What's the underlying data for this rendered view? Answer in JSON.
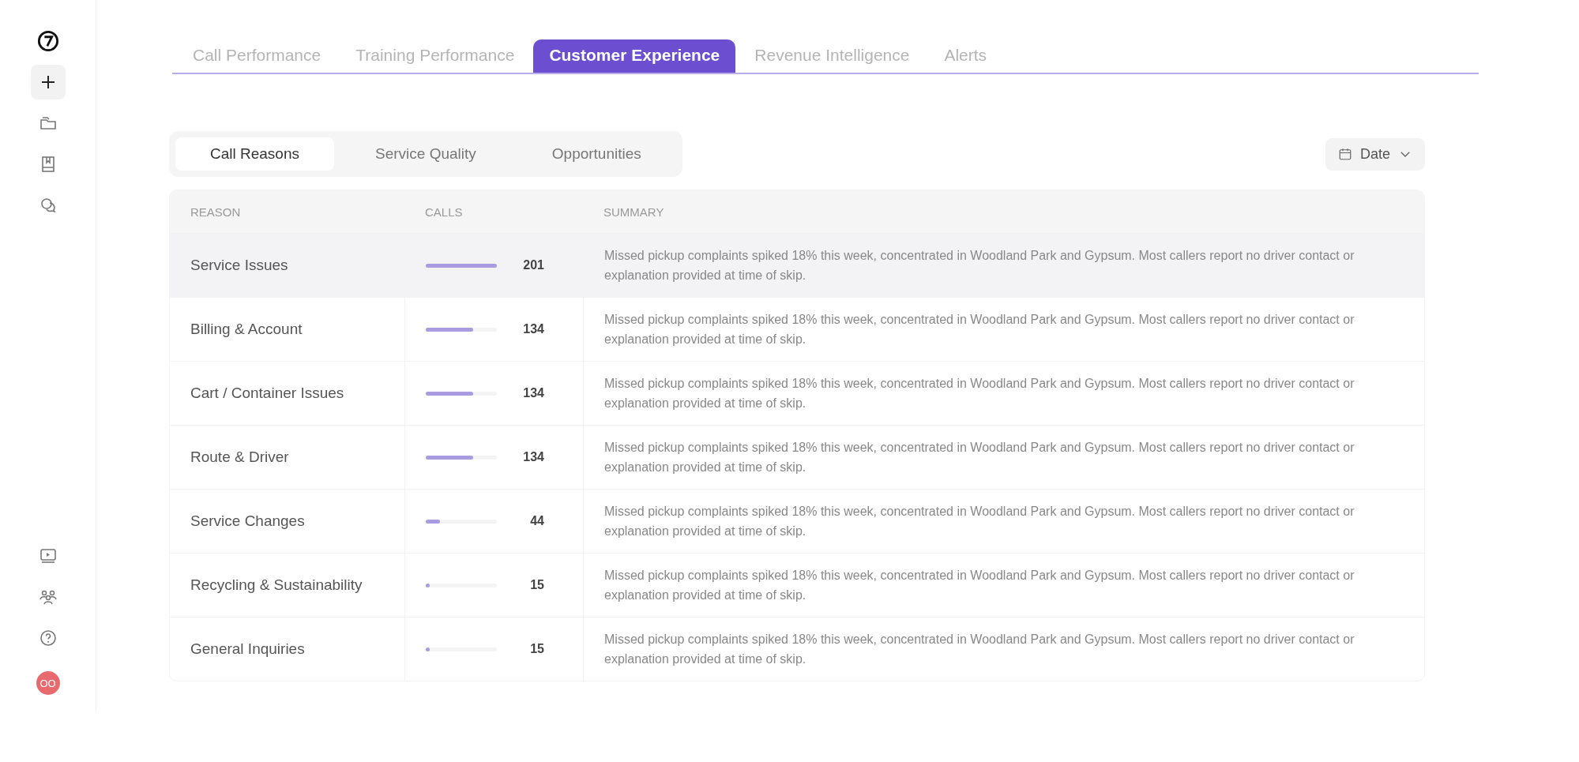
{
  "sidebar": {
    "top_items": [
      {
        "kind": "logo"
      },
      {
        "kind": "plus",
        "selected": true
      },
      {
        "kind": "folder",
        "selected": false
      },
      {
        "kind": "book",
        "selected": false
      },
      {
        "kind": "chat",
        "selected": false
      }
    ],
    "bottom_items": [
      {
        "kind": "video"
      },
      {
        "kind": "team"
      },
      {
        "kind": "help"
      }
    ],
    "avatar": {
      "initials": "OO",
      "color": "#e86a6f"
    }
  },
  "tabs": [
    {
      "label": "Call Performance",
      "selected": false
    },
    {
      "label": "Training Performance",
      "selected": false
    },
    {
      "label": "Customer Experience",
      "selected": true
    },
    {
      "label": "Revenue Intelligence",
      "selected": false
    },
    {
      "label": "Alerts",
      "selected": false
    }
  ],
  "subtabs": [
    {
      "label": "Call Reasons",
      "selected": true
    },
    {
      "label": "Service Quality",
      "selected": false
    },
    {
      "label": "Opportunities",
      "selected": false
    }
  ],
  "date_button": {
    "label": "Date"
  },
  "table": {
    "columns": [
      "REASON",
      "CALLS",
      "SUMMARY"
    ],
    "rows": [
      {
        "reason": "Service Issues",
        "level": 1,
        "calls": "201",
        "summary": "Missed pickup complaints spiked 18% this week, concentrated in Woodland Park and Gypsum. Most callers report no driver contact or explanation provided at time of skip.",
        "highlighted": true
      },
      {
        "reason": "Billing & Account",
        "level": 0.67,
        "calls": "134",
        "summary": "Missed pickup complaints spiked 18% this week, concentrated in Woodland Park and Gypsum. Most callers report no driver contact or explanation provided at time of skip.",
        "highlighted": false
      },
      {
        "reason": "Cart / Container Issues",
        "level": 0.67,
        "calls": "134",
        "summary": "Missed pickup complaints spiked 18% this week, concentrated in Woodland Park and Gypsum. Most callers report no driver contact or explanation provided at time of skip.",
        "highlighted": false
      },
      {
        "reason": "Route & Driver",
        "level": 0.67,
        "calls": "134",
        "summary": "Missed pickup complaints spiked 18% this week, concentrated in Woodland Park and Gypsum. Most callers report no driver contact or explanation provided at time of skip.",
        "highlighted": false
      },
      {
        "reason": "Service Changes",
        "level": 0.2,
        "calls": "44",
        "summary": "Missed pickup complaints spiked 18% this week, concentrated in Woodland Park and Gypsum. Most callers report no driver contact or explanation provided at time of skip.",
        "highlighted": false
      },
      {
        "reason": "Recycling & Sustainability",
        "level": 0.06,
        "calls": "15",
        "summary": "Missed pickup complaints spiked 18% this week, concentrated in Woodland Park and Gypsum. Most callers report no driver contact or explanation provided at time of skip.",
        "highlighted": false
      },
      {
        "reason": "General Inquiries",
        "level": 0.06,
        "calls": "15",
        "summary": "Missed pickup complaints spiked 18% this week, concentrated in Woodland Park and Gypsum. Most callers report no driver contact or explanation provided at time of skip.",
        "highlighted": false
      }
    ]
  }
}
